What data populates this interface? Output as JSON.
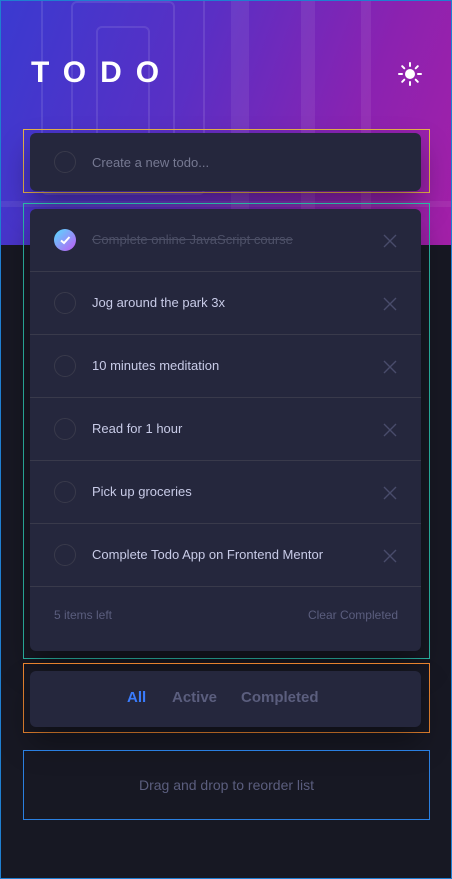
{
  "app": {
    "title": "TODO"
  },
  "theme_toggle": {
    "icon": "sun-icon"
  },
  "new_todo": {
    "placeholder": "Create a new todo..."
  },
  "todos": [
    {
      "label": "Complete online JavaScript course",
      "completed": true
    },
    {
      "label": "Jog around the park 3x",
      "completed": false
    },
    {
      "label": "10 minutes meditation",
      "completed": false
    },
    {
      "label": "Read for 1 hour",
      "completed": false
    },
    {
      "label": "Pick up groceries",
      "completed": false
    },
    {
      "label": "Complete Todo App on Frontend Mentor",
      "completed": false
    }
  ],
  "footer": {
    "items_left": "5 items left",
    "clear_completed": "Clear Completed"
  },
  "filters": {
    "all": "All",
    "active": "Active",
    "completed": "Completed",
    "selected": "All"
  },
  "hint": "Drag and drop to reorder list",
  "colors": {
    "accent": "#3a7cfd",
    "card": "#25273d",
    "background": "#171823",
    "gradient_start": "#55ddff",
    "gradient_end": "#c058f3"
  }
}
